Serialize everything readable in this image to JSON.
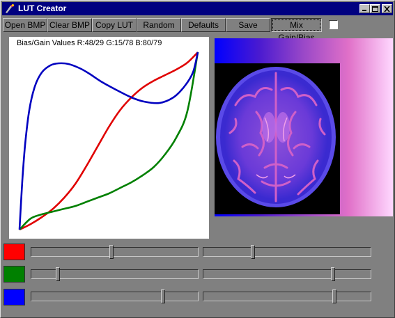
{
  "window": {
    "title": "LUT Creator"
  },
  "toolbar": {
    "buttons": [
      "Open BMP",
      "Clear BMP",
      "Copy LUT",
      "Random",
      "Defaults",
      "Save",
      "Mix Gain/Bias"
    ],
    "mix_checkbox_checked": false
  },
  "chart_data": {
    "type": "line",
    "title": "Bias/Gain Values R:48/29 G:15/78 B:80/79",
    "xlabel": "",
    "ylabel": "",
    "xlim": [
      0,
      255
    ],
    "ylim": [
      0,
      255
    ],
    "grid": false,
    "series": [
      {
        "color": "#e00000",
        "x": [
          0,
          16,
          32,
          48,
          64,
          80,
          96,
          112,
          128,
          144,
          160,
          176,
          192,
          208,
          224,
          240,
          255
        ],
        "y": [
          0,
          8,
          18,
          30,
          46,
          66,
          92,
          120,
          148,
          172,
          190,
          204,
          214,
          222,
          230,
          240,
          255
        ]
      },
      {
        "color": "#008000",
        "x": [
          0,
          16,
          32,
          48,
          64,
          80,
          96,
          112,
          128,
          144,
          160,
          176,
          192,
          208,
          224,
          240,
          255
        ],
        "y": [
          0,
          16,
          22,
          26,
          30,
          34,
          40,
          46,
          52,
          60,
          68,
          78,
          90,
          108,
          132,
          170,
          255
        ]
      },
      {
        "color": "#0000c0",
        "x": [
          0,
          4,
          8,
          14,
          22,
          32,
          44,
          56,
          70,
          86,
          100,
          118,
          140,
          160,
          178,
          200,
          220,
          236,
          248,
          255
        ],
        "y": [
          0,
          70,
          122,
          172,
          206,
          226,
          236,
          239,
          238,
          232,
          224,
          212,
          200,
          190,
          184,
          182,
          190,
          206,
          226,
          255
        ]
      }
    ]
  },
  "image_view": {
    "lut_gradient_colors": [
      "#0000ff",
      "#4a1ad0",
      "#9a48c8",
      "#e070c8",
      "#ffd8ff"
    ],
    "brain_colors": [
      "#000000",
      "#3a2ad0",
      "#8c50d8",
      "#d060c8"
    ]
  },
  "channels": [
    {
      "name": "red",
      "color": "#ff0000",
      "bias": 0.48,
      "gain": 0.29
    },
    {
      "name": "green",
      "color": "#008000",
      "bias": 0.15,
      "gain": 0.78
    },
    {
      "name": "blue",
      "color": "#0000ff",
      "bias": 0.8,
      "gain": 0.79
    }
  ],
  "icons": {
    "app": "lut-creator-app-icon",
    "minimize": "minimize-icon",
    "maximize": "maximize-icon",
    "close": "close-icon"
  }
}
